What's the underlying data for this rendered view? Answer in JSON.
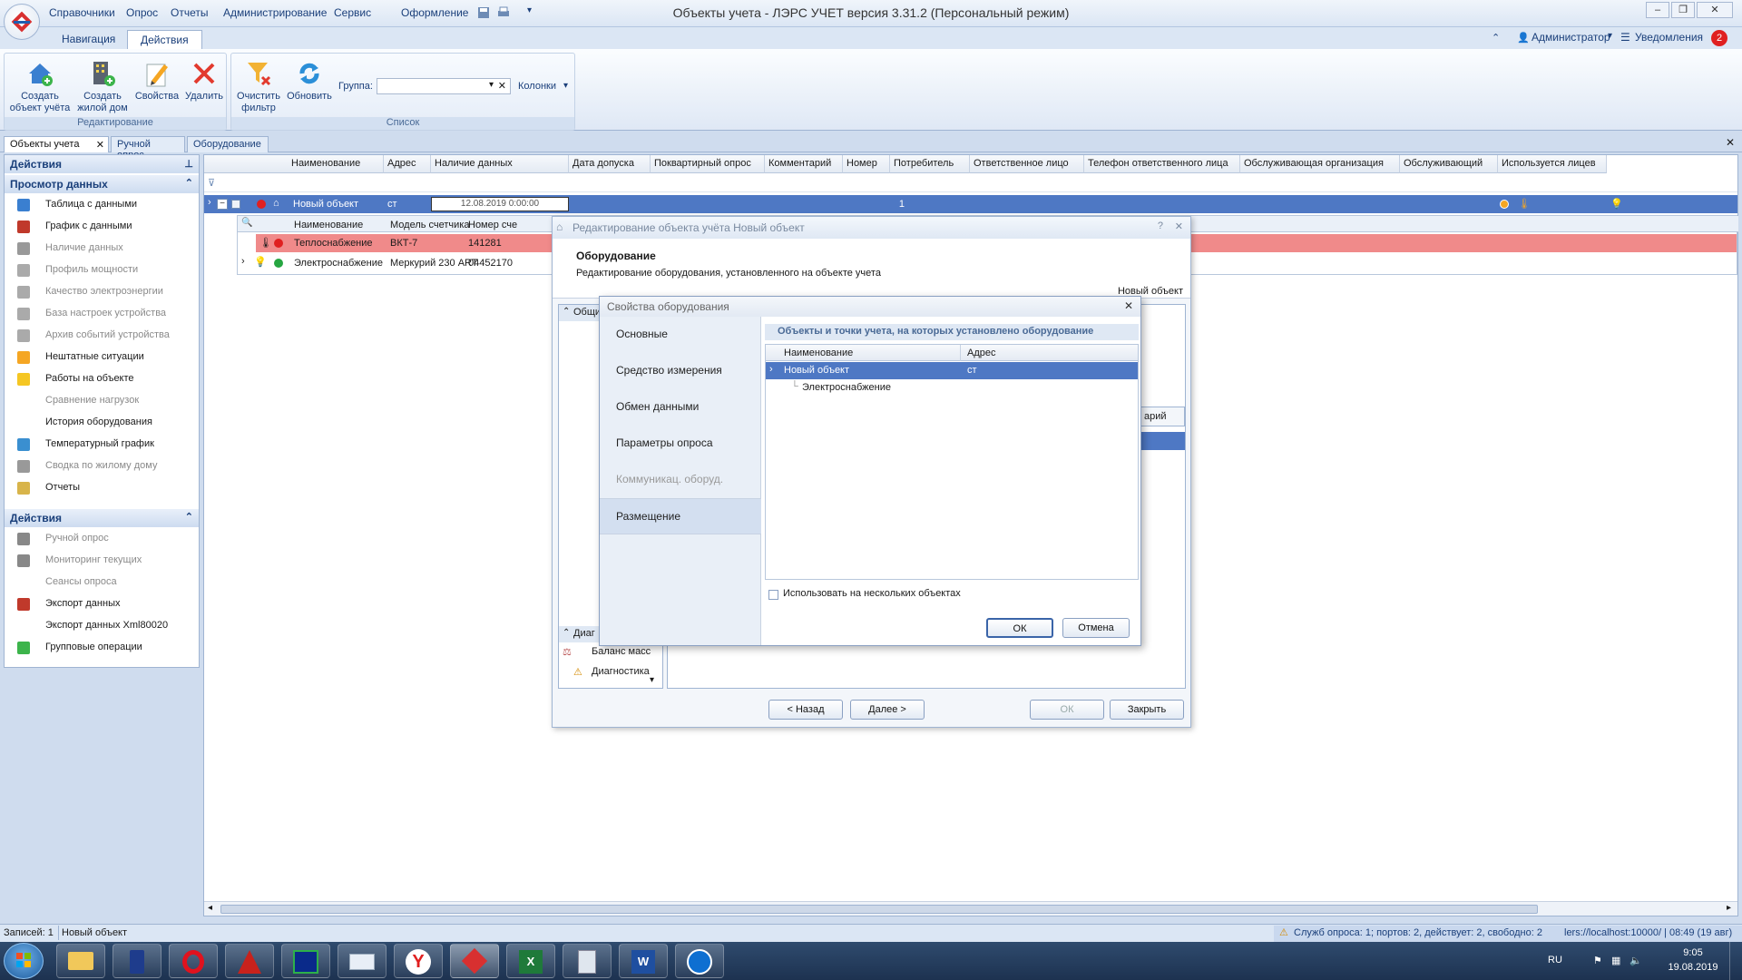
{
  "window": {
    "title": "Объекты учета - ЛЭРС УЧЕТ версия 3.31.2 (Персональный режим)",
    "menu": [
      "Справочники",
      "Опрос",
      "Отчеты",
      "Администрирование",
      "Сервис",
      "Оформление"
    ],
    "admin_label": "Администратор",
    "notifications_label": "Уведомления",
    "notifications_count": "2"
  },
  "ribbon": {
    "tabs": [
      "Навигация",
      "Действия"
    ],
    "active_tab": "Действия",
    "groups": {
      "edit_label": "Редактирование",
      "list_label": "Список"
    },
    "buttons": {
      "create_object": "Создать объект учёта",
      "create_house": "Создать жилой дом",
      "properties": "Свойства",
      "delete": "Удалить",
      "clear_filter": "Очистить фильтр",
      "refresh": "Обновить"
    },
    "group_field_label": "Группа:",
    "group_field_value": "",
    "columns_label": "Колонки"
  },
  "doc_tabs": [
    "Объекты учета",
    "Ручной опрос",
    "Оборудование"
  ],
  "left_panel": {
    "section1_title": "Действия",
    "view_title": "Просмотр данных",
    "view_items": [
      {
        "label": "Таблица с данными",
        "enabled": true,
        "icon": "table-icon"
      },
      {
        "label": "График с данными",
        "enabled": true,
        "icon": "chart-icon"
      },
      {
        "label": "Наличие данных",
        "enabled": false,
        "icon": "data-presence-icon"
      },
      {
        "label": "Профиль мощности",
        "enabled": false,
        "icon": "power-profile-icon"
      },
      {
        "label": "Качество электроэнергии",
        "enabled": false,
        "icon": "power-quality-icon"
      },
      {
        "label": "База настроек устройства",
        "enabled": false,
        "icon": "device-settings-icon"
      },
      {
        "label": "Архив событий устройства",
        "enabled": false,
        "icon": "event-archive-icon"
      },
      {
        "label": "Нештатные ситуации",
        "enabled": true,
        "icon": "warning-icon"
      },
      {
        "label": "Работы на объекте",
        "enabled": true,
        "icon": "hardhat-icon"
      },
      {
        "label": "Сравнение нагрузок",
        "enabled": false,
        "icon": "load-compare-icon"
      },
      {
        "label": "История оборудования",
        "enabled": true,
        "icon": "history-icon"
      },
      {
        "label": "Температурный график",
        "enabled": true,
        "icon": "temperature-icon"
      },
      {
        "label": "Сводка по жилому дому",
        "enabled": false,
        "icon": "house-summary-icon"
      },
      {
        "label": "Отчеты",
        "enabled": true,
        "icon": "report-icon"
      }
    ],
    "actions_title": "Действия",
    "action_items": [
      {
        "label": "Ручной опрос",
        "enabled": false,
        "icon": "play-icon"
      },
      {
        "label": "Мониторинг текущих",
        "enabled": false,
        "icon": "monitor-icon"
      },
      {
        "label": "Сеансы опроса",
        "enabled": false,
        "icon": "session-icon"
      },
      {
        "label": "Экспорт данных",
        "enabled": true,
        "icon": "export-icon"
      },
      {
        "label": "Экспорт данных Xml80020",
        "enabled": true,
        "icon": "xml-export-icon"
      },
      {
        "label": "Групповые операции",
        "enabled": true,
        "icon": "check-icon"
      }
    ]
  },
  "grid": {
    "columns": [
      "Наименование",
      "Адрес",
      "Наличие данных",
      "Дата допуска",
      "Поквартирный опрос",
      "Комментарий",
      "Номер",
      "Потребитель",
      "Ответственное лицо",
      "Телефон ответственного лица",
      "Обслуживающая организация",
      "Обслуживающий",
      "Используется лицев"
    ],
    "main_row": {
      "name": "Новый объект",
      "address": "ст",
      "data_date": "12.08.2019 0:00:00",
      "number": "1"
    },
    "sub_columns": [
      "Наименование",
      "Модель счетчика",
      "Номер сче"
    ],
    "sub_rows": [
      {
        "name": "Теплоснабжение",
        "model": "ВКТ-7",
        "number": "141281",
        "status": "error"
      },
      {
        "name": "Электроснабжение",
        "model": "Меркурий 230 ART",
        "number": "04452170",
        "status": "ok"
      }
    ]
  },
  "dialog_edit": {
    "title": "Редактирование объекта учёта Новый объект",
    "header_title": "Оборудование",
    "header_desc": "Редактирование оборудования, установленного на объекте учета",
    "object_name": "Новый объект",
    "tree_section_general": "Общи",
    "tree_section_diag": "Диаг",
    "tree_items_bottom": [
      "Баланс масс",
      "Диагностика"
    ],
    "comment_fragment": "арий",
    "buttons": {
      "back": "< Назад",
      "next": "Далее >",
      "ok": "ОК",
      "close": "Закрыть"
    }
  },
  "dialog_props": {
    "title": "Свойства оборудования",
    "nav": [
      {
        "label": "Основные",
        "enabled": true
      },
      {
        "label": "Средство измерения",
        "enabled": true
      },
      {
        "label": "Обмен данными",
        "enabled": true
      },
      {
        "label": "Параметры опроса",
        "enabled": true
      },
      {
        "label": "Коммуникац. оборуд.",
        "enabled": false
      },
      {
        "label": "Размещение",
        "enabled": true,
        "active": true
      }
    ],
    "section_title": "Объекты и точки учета, на которых установлено оборудование",
    "table_columns": [
      "Наименование",
      "Адрес"
    ],
    "table_rows": [
      {
        "name": "Новый объект",
        "address": "ст",
        "selected": true
      },
      {
        "name": "Электроснабжение",
        "address": "",
        "child": true
      }
    ],
    "checkbox_label": "Использовать на нескольких объектах",
    "checkbox_checked": false,
    "ok": "ОК",
    "cancel": "Отмена"
  },
  "statusbar": {
    "records": "Записей: 1",
    "selected": "Новый объект",
    "service": "Служб опроса: 1; портов: 2, действует: 2, свободно: 2",
    "server": "lers://localhost:10000/ | 08:49 (19 авг)"
  },
  "taskbar": {
    "lang": "RU",
    "time": "9:05",
    "date": "19.08.2019",
    "apps": [
      "explorer",
      "document",
      "opera",
      "acrobat",
      "far",
      "mail",
      "yandex",
      "lers",
      "excel",
      "calculator",
      "word",
      "teamviewer"
    ]
  },
  "colors": {
    "accent": "#4e78c4",
    "error_row": "#f08a8a",
    "frame": "#9fb4d2"
  }
}
